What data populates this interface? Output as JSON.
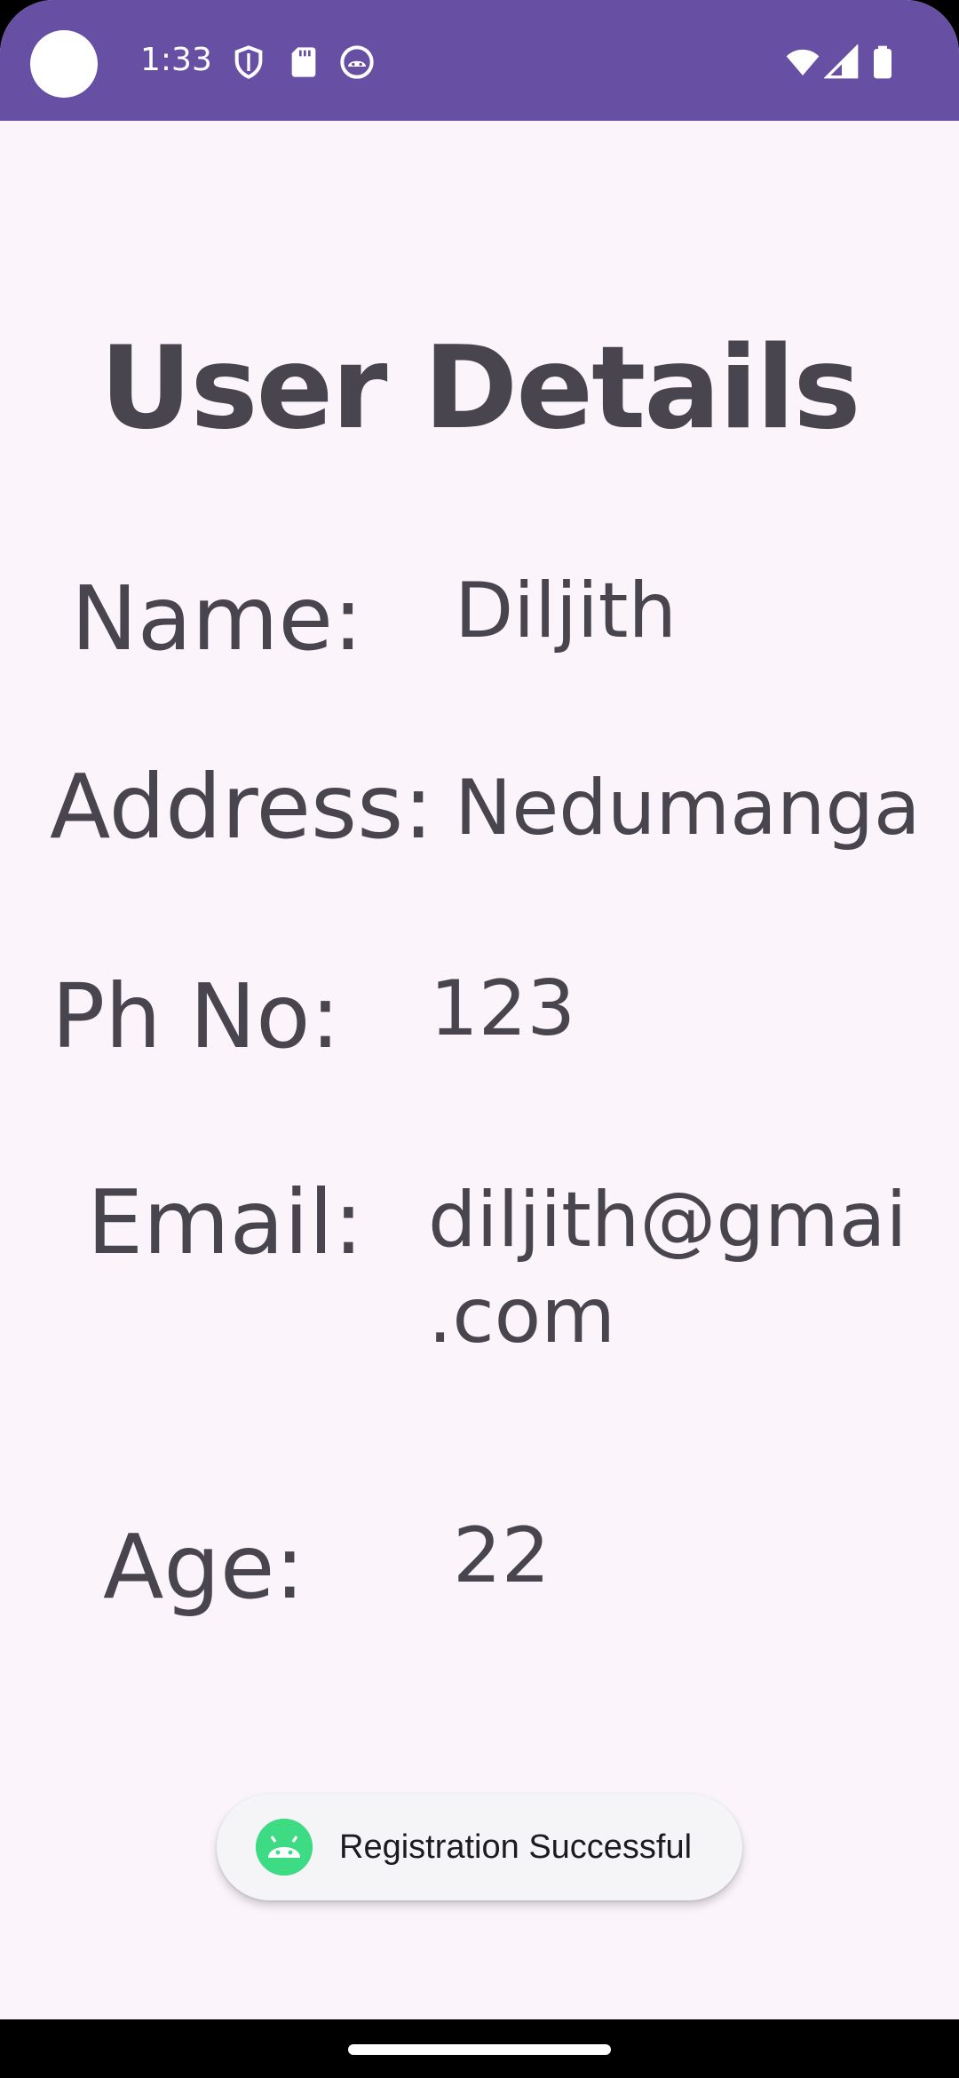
{
  "status_bar": {
    "time": "1:33",
    "background_color": "#6750a4",
    "icons_left": [
      "shield-icon",
      "sd-card-icon",
      "android-head-icon"
    ],
    "icons_right": [
      "wifi-icon",
      "cell-signal-icon",
      "battery-icon"
    ]
  },
  "page": {
    "title": "User Details",
    "background_color": "#fcf4fb",
    "text_color": "#49454f"
  },
  "fields": {
    "name": {
      "label": "Name:",
      "value": "Diljith"
    },
    "address": {
      "label": "Address:",
      "value": "Nedumanga"
    },
    "phone": {
      "label": "Ph No:",
      "value": "123"
    },
    "email": {
      "label": "Email:",
      "value_line1": "diljith@gmai",
      "value_line2": ".com"
    },
    "age": {
      "label": "Age:",
      "value": "22"
    }
  },
  "toast": {
    "icon": "android-icon",
    "message": "Registration Successful"
  }
}
